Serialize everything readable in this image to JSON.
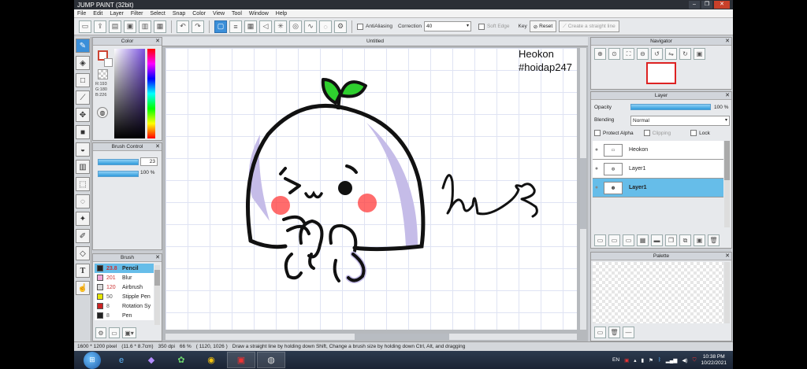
{
  "app": {
    "title": "JUMP PAINT (32bit)"
  },
  "menu": [
    "File",
    "Edit",
    "Layer",
    "Filter",
    "Select",
    "Snap",
    "Color",
    "View",
    "Tool",
    "Window",
    "Help"
  ],
  "toolbar": {
    "antialiasing_label": "AntiAliasing",
    "correction_label": "Correction",
    "correction_value": "40",
    "soft_edge_label": "Soft Edge",
    "key_label": "Key",
    "reset_label": "Reset",
    "straight_line_label": "Create a straight line"
  },
  "color_panel": {
    "title": "Color",
    "r": "R:193",
    "g": "G:180",
    "b": "B:226",
    "fg_color": "#c1b4e2",
    "bg_color": "#ffffff"
  },
  "brush_control": {
    "title": "Brush Control",
    "size": "23",
    "opacity": "100 %"
  },
  "brush_panel": {
    "title": "Brush",
    "items": [
      {
        "size": "23.8",
        "name": "Pencil",
        "color": "#222222",
        "selected": true
      },
      {
        "size": "201",
        "name": "Blur",
        "color": "#f2a6d8"
      },
      {
        "size": "120",
        "name": "Airbrush",
        "color": "#d9d9d9"
      },
      {
        "size": "50",
        "name": "Stipple Pen",
        "color": "#e6e600"
      },
      {
        "size": "8",
        "name": "Rotation Sy",
        "color": "#cc2222"
      },
      {
        "size": "8",
        "name": "Pen",
        "color": "#222222"
      }
    ]
  },
  "document": {
    "tab": "Untitled",
    "text1": "Heokon",
    "text2": "#hoidap247"
  },
  "navigator": {
    "title": "Navigator"
  },
  "layer_panel": {
    "title": "Layer",
    "opacity_label": "Opacity",
    "opacity_value": "100 %",
    "opacity_fraction": 1.0,
    "blending_label": "Blending",
    "blending_value": "Normal",
    "protect_alpha": "Protect Alpha",
    "clipping": "Clipping",
    "lock": "Lock",
    "layers": [
      {
        "name": "Heokon",
        "selected": false
      },
      {
        "name": "Layer1",
        "selected": false
      },
      {
        "name": "Layer1",
        "selected": true
      }
    ]
  },
  "palette": {
    "title": "Palette"
  },
  "status": {
    "size": "1600 * 1200 pixel",
    "cm": "(11.6 * 8.7cm)",
    "dpi": "350 dpi",
    "zoom": "66 %",
    "coords": "( 1120, 1026 )",
    "hint": "Draw a straight line by holding down Shift, Change a brush size by holding down Ctrl, Alt, and dragging"
  },
  "taskbar": {
    "lang": "EN",
    "time": "10:38 PM",
    "date": "10/22/2021"
  }
}
